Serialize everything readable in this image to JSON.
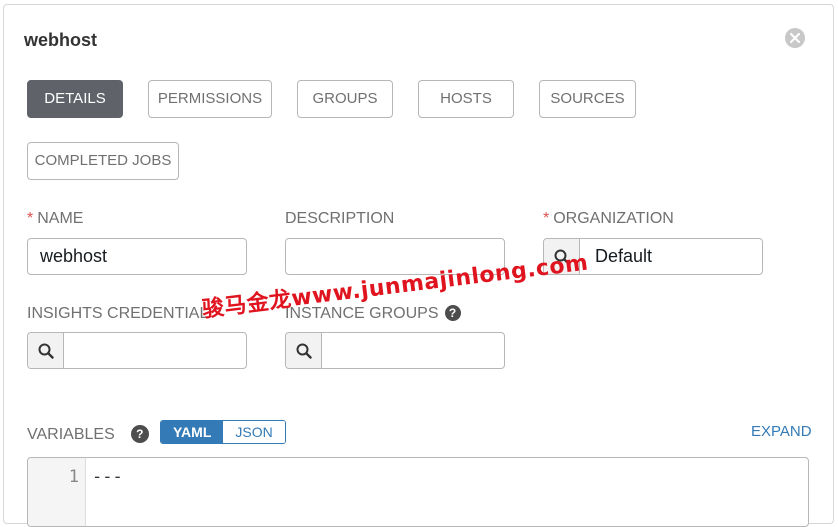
{
  "panel": {
    "title": "webhost"
  },
  "tabs": [
    {
      "label": "DETAILS",
      "active": true
    },
    {
      "label": "PERMISSIONS",
      "active": false
    },
    {
      "label": "GROUPS",
      "active": false
    },
    {
      "label": "HOSTS",
      "active": false
    },
    {
      "label": "SOURCES",
      "active": false
    },
    {
      "label": "COMPLETED JOBS",
      "active": false
    }
  ],
  "form": {
    "name": {
      "label": "NAME",
      "required_mark": "*",
      "value": "webhost"
    },
    "description": {
      "label": "DESCRIPTION",
      "value": ""
    },
    "organization": {
      "label": "ORGANIZATION",
      "required_mark": "*",
      "value": "Default"
    },
    "insights_credential": {
      "label": "INSIGHTS CREDENTIAL",
      "value": ""
    },
    "instance_groups": {
      "label": "INSTANCE GROUPS",
      "value": "",
      "help_icon": "question-circle-icon",
      "help_glyph": "?"
    },
    "variables": {
      "label": "VARIABLES",
      "help_icon": "question-circle-icon",
      "help_glyph": "?",
      "toggle": {
        "yaml": "YAML",
        "json": "JSON",
        "selected": "YAML"
      },
      "expand_label": "EXPAND",
      "line_number": "1",
      "code": "---"
    }
  },
  "watermark": "骏马金龙www.junmajinlong.com",
  "colors": {
    "active_tab": "#5f6369",
    "link": "#337ab7",
    "required": "#d9534f",
    "watermark": "#e0141e"
  }
}
